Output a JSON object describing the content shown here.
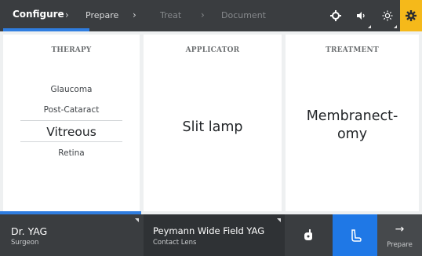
{
  "nav": {
    "steps": [
      {
        "label": "Configure",
        "state": "active"
      },
      {
        "label": "Prepare",
        "state": "normal"
      },
      {
        "label": "Treat",
        "state": "disabled"
      },
      {
        "label": "Document",
        "state": "disabled"
      }
    ],
    "separator": "›",
    "icons": [
      "aim-icon",
      "volume-icon",
      "brightness-icon",
      "settings-gear-icon"
    ]
  },
  "columns": {
    "therapy": {
      "title": "THERAPY",
      "items": [
        "Glaucoma",
        "Post-Cataract",
        "Vitreous",
        "Retina"
      ],
      "selected": "Vitreous"
    },
    "applicator": {
      "title": "APPLICATOR",
      "value": "Slit lamp"
    },
    "treatment": {
      "title": "TREATMENT",
      "value_line1": "Membranect-",
      "value_line2": "omy"
    }
  },
  "bottom": {
    "surgeon": {
      "name": "Dr. YAG",
      "label": "Surgeon"
    },
    "lens": {
      "name": "Peymann Wide Field YAG",
      "label": "Contact Lens"
    },
    "tool_icon": "joystick-hand-icon",
    "foot_icon": "footswitch-icon",
    "next": {
      "arrow": "→",
      "label": "Prepare"
    }
  },
  "colors": {
    "bar": "#3a3d40",
    "accent_blue": "#2f7de0",
    "foot_blue": "#1f78e6",
    "highlight_yellow": "#f5b91a"
  }
}
